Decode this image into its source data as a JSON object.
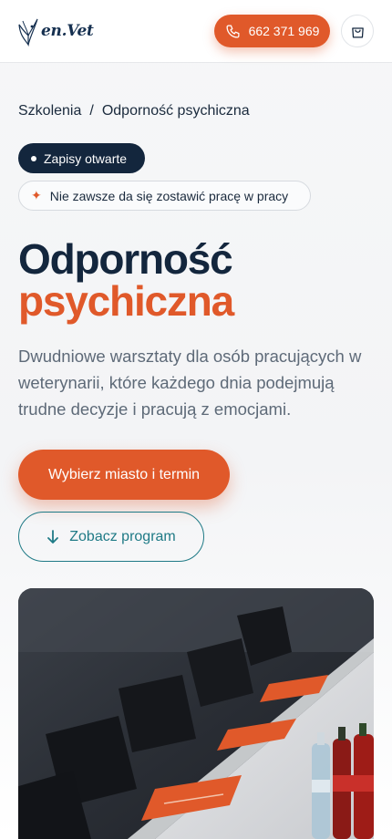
{
  "header": {
    "logo_text": "en.Vet",
    "phone": "662 371 969",
    "icons": {
      "logo": "bird-logo-icon",
      "phone": "phone-icon",
      "cart": "shopping-bag-icon"
    }
  },
  "breadcrumb": {
    "items": [
      "Szkolenia",
      "Odporność psychiczna"
    ],
    "separator": "/"
  },
  "badges": {
    "status": "Zapisy otwarte",
    "tagline": "Nie zawsze da się zostawić pracę w pracy",
    "tagline_icon": "sparkle-icon"
  },
  "hero": {
    "title_line1": "Odporność",
    "title_line2": "psychiczna",
    "description": "Dwudniowe warsztaty dla osób pracujących w weterynarii, które każdego dnia podejmują trudne decyzje i pracują z emocjami.",
    "cta_primary": "Wybierz miasto i termin",
    "cta_secondary": "Zobacz program",
    "cta_secondary_icon": "arrow-down-icon"
  },
  "colors": {
    "accent": "#e0592a",
    "navy": "#13263d",
    "teal": "#1f7a86"
  }
}
